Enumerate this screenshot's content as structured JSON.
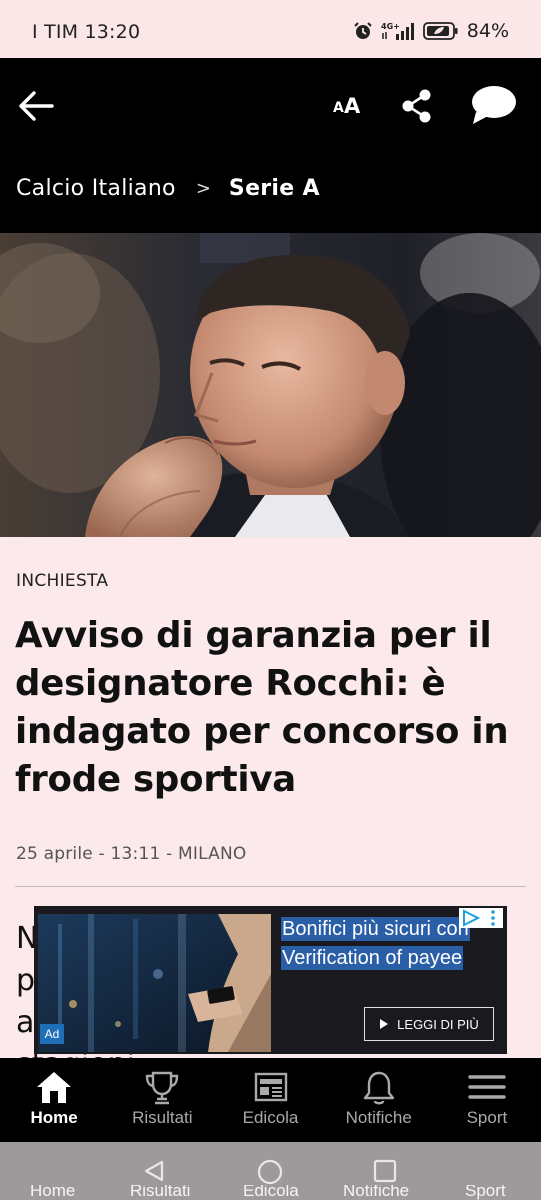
{
  "status_bar": {
    "carrier_time": "I TIM 13:20",
    "network": "4G+",
    "battery": "84%"
  },
  "app_bar": {
    "text_size_small": "A",
    "text_size_large": "A",
    "breadcrumb": [
      "Calcio Italiano",
      "Serie A"
    ],
    "breadcrumb_separator": ">"
  },
  "article": {
    "kicker": "INCHIESTA",
    "headline": "Avviso di garanzia per il designatore Rocchi: è indagato per concorso in frode sportiva",
    "meta": "25 aprile - 13:11 - MILANO",
    "body_lines": [
      "N",
      "p",
      "a",
      "stagioni"
    ]
  },
  "ad": {
    "headline": "Bonifici più sicuri con Verification of payee",
    "cta": "LEGGI DI PIÙ",
    "badge": "Ad"
  },
  "bottom_nav": {
    "items": [
      {
        "label": "Home",
        "icon": "home-icon",
        "active": true
      },
      {
        "label": "Risultati",
        "icon": "trophy-icon",
        "active": false
      },
      {
        "label": "Edicola",
        "icon": "newspaper-icon",
        "active": false
      },
      {
        "label": "Notifiche",
        "icon": "bell-icon",
        "active": false
      },
      {
        "label": "Sport",
        "icon": "menu-icon",
        "active": false
      }
    ]
  },
  "system_nav": {
    "buttons": [
      "back-triangle-icon",
      "home-circle-icon",
      "recents-square-icon"
    ]
  },
  "colors": {
    "background": "#fbe9eb",
    "app_bar": "#000000",
    "ad_highlight": "#2a5fa8",
    "nav_active": "#ffffff",
    "nav_inactive": "#a9a9a9"
  }
}
